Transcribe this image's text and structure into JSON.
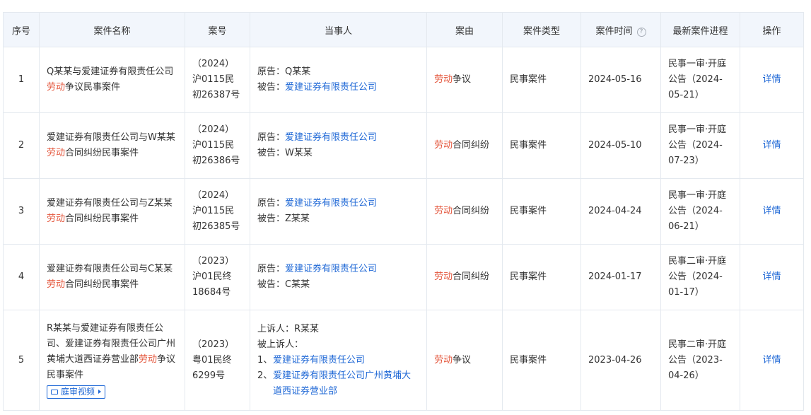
{
  "header": {
    "index": "序号",
    "name": "案件名称",
    "case_no": "案号",
    "parties": "当事人",
    "cause": "案由",
    "type": "案件类型",
    "time": "案件时间",
    "time_help": "?",
    "progress": "最新案件进程",
    "action": "操作"
  },
  "rows": [
    {
      "index": "1",
      "name_parts": [
        "Q某某与爱建证券有限责任公司",
        "劳动",
        "争议民事案件"
      ],
      "case_no": "（2024）沪0115民初26387号",
      "p1_label": "原告：",
      "p1_value": "Q某某",
      "p2_label": "被告：",
      "p2_value": "爱建证券有限责任公司",
      "cause_hl": "劳动",
      "cause_rest": "争议",
      "type": "民事案件",
      "time": "2024-05-16",
      "progress": "民事一审·开庭公告（2024-05-21）",
      "action": "详情"
    },
    {
      "index": "2",
      "name_parts": [
        "爱建证券有限责任公司与W某某",
        "劳动",
        "合同纠纷民事案件"
      ],
      "case_no": "（2024）沪0115民初26386号",
      "p1_label": "原告：",
      "p1_value": "爱建证券有限责任公司",
      "p2_label": "被告：",
      "p2_value": "W某某",
      "cause_hl": "劳动",
      "cause_rest": "合同纠纷",
      "type": "民事案件",
      "time": "2024-05-10",
      "progress": "民事一审·开庭公告（2024-07-23）",
      "action": "详情"
    },
    {
      "index": "3",
      "name_parts": [
        "爱建证券有限责任公司与Z某某",
        "劳动",
        "合同纠纷民事案件"
      ],
      "case_no": "（2024）沪0115民初26385号",
      "p1_label": "原告：",
      "p1_value": "爱建证券有限责任公司",
      "p2_label": "被告：",
      "p2_value": "Z某某",
      "cause_hl": "劳动",
      "cause_rest": "合同纠纷",
      "type": "民事案件",
      "time": "2024-04-24",
      "progress": "民事一审·开庭公告（2024-06-21）",
      "action": "详情"
    },
    {
      "index": "4",
      "name_parts": [
        "爱建证券有限责任公司与C某某",
        "劳动",
        "合同纠纷民事案件"
      ],
      "case_no": "（2023）沪01民终18684号",
      "p1_label": "原告：",
      "p1_value": "爱建证券有限责任公司",
      "p2_label": "被告：",
      "p2_value": "C某某",
      "cause_hl": "劳动",
      "cause_rest": "合同纠纷",
      "type": "民事案件",
      "time": "2024-01-17",
      "progress": "民事二审·开庭公告（2024-01-17）",
      "action": "详情"
    },
    {
      "index": "5",
      "name_parts": [
        "R某某与爱建证券有限责任公司、爱建证券有限责任公司广州黄埔大道西证券营业部",
        "劳动",
        "争议民事案件"
      ],
      "video_label": "庭审视频",
      "case_no": "（2023）粤01民终6299号",
      "appellant_label": "上诉人：",
      "appellant_value": "R某某",
      "appellee_label": "被上诉人：",
      "appellee_items": [
        {
          "num": "1、",
          "text": "爱建证券有限责任公司"
        },
        {
          "num": "2、",
          "text": "爱建证券有限责任公司广州黄埔大道西证券营业部"
        }
      ],
      "cause_hl": "劳动",
      "cause_rest": "争议",
      "type": "民事案件",
      "time": "2023-04-26",
      "progress": "民事二审·开庭公告（2023-04-26）",
      "action": "详情"
    }
  ]
}
